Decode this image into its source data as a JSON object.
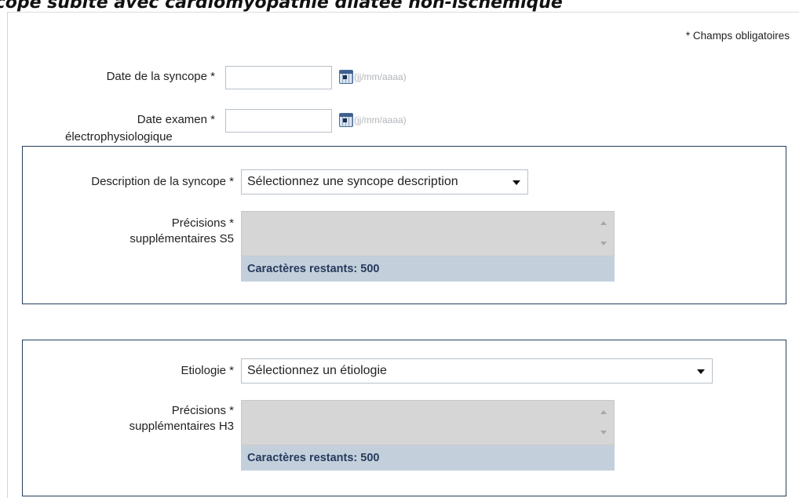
{
  "header": {
    "title": "ncope subite avec cardiomyopathie dilatée non-ischémique"
  },
  "form": {
    "required_note": "* Champs obligatoires",
    "date_syncope": {
      "label": "Date de la syncope *",
      "value": "",
      "hint": "(jj/mm/aaaa)",
      "icon": "calendar-icon"
    },
    "date_exam": {
      "label_line1": "Date examen *",
      "label_line2": "électrophysiologique",
      "value": "",
      "hint": "(jj/mm/aaaa)",
      "icon": "calendar-icon"
    },
    "description_section": {
      "label": "Description de la syncope *",
      "selected": "Sélectionnez une syncope description",
      "details_label_line1": "Précisions *",
      "details_label_line2": "supplémentaires S5",
      "details_value": "",
      "remaining": "Caractères restants: 500"
    },
    "etiology_section": {
      "label": "Etiologie *",
      "selected": "Sélectionnez un étiologie",
      "details_label_line1": "Précisions *",
      "details_label_line2": "supplémentaires H3",
      "details_value": "",
      "remaining": "Caractères restants: 500"
    }
  },
  "colors": {
    "section_border": "#243f5c",
    "char_count_bg": "#c3d0dc",
    "textarea_bg": "#d6d6d6",
    "char_count_text": "#273a5c"
  }
}
